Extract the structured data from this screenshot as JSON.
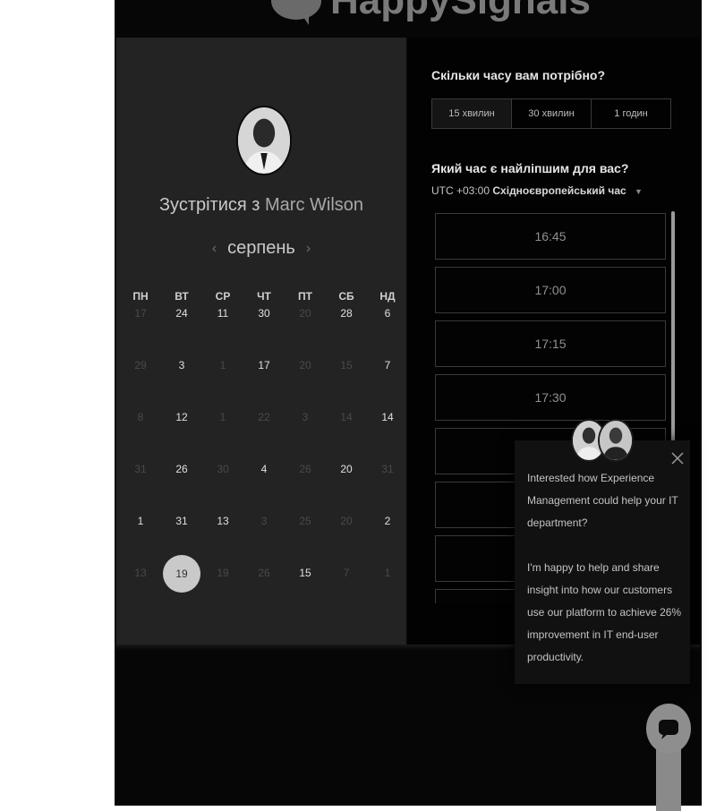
{
  "brand": {
    "name": "HappySignals"
  },
  "host": {
    "prefix": "Зустрітися з",
    "name": "Marc Wilson"
  },
  "calendar": {
    "month": "серпень",
    "weekdays": [
      "ПН",
      "ВТ",
      "СР",
      "ЧТ",
      "ПТ",
      "СБ",
      "НД"
    ],
    "weeks": [
      [
        "17",
        "24",
        "11",
        "30",
        "20",
        "28",
        "6"
      ],
      [
        "29",
        "3",
        "1",
        "17",
        "20",
        "15",
        "7"
      ],
      [
        "8",
        "12",
        "1",
        "22",
        "3",
        "14",
        "14"
      ],
      [
        "31",
        "26",
        "30",
        "4",
        "26",
        "20",
        "31"
      ],
      [
        "1",
        "31",
        "13",
        "3",
        "25",
        "20",
        "2"
      ],
      [
        "13",
        "19",
        "19",
        "26",
        "15",
        "7",
        "1"
      ]
    ],
    "selected_day": "19"
  },
  "duration": {
    "question": "Скільки часу вам потрібно?",
    "options": [
      "15 хвилин",
      "30 хвилин",
      "1 годин"
    ]
  },
  "time": {
    "question": "Який час є найліпшим для вас?",
    "tz_offset": "UTC +03:00",
    "tz_name": "Східноєвропейський час",
    "slots": [
      "16:45",
      "17:00",
      "17:15",
      "17:30",
      "",
      "",
      "",
      ""
    ]
  },
  "popup": {
    "paragraph1": "Interested how Experience Management could help your IT department?",
    "paragraph2": "I'm happy to help and share insight into how our customers use our platform to achieve 26% improvement in IT end-user productivity."
  },
  "colors": {
    "background": "#060606",
    "left_panel": "#232323",
    "right_panel": "#020202",
    "selected_day": "#c9c9c9"
  }
}
